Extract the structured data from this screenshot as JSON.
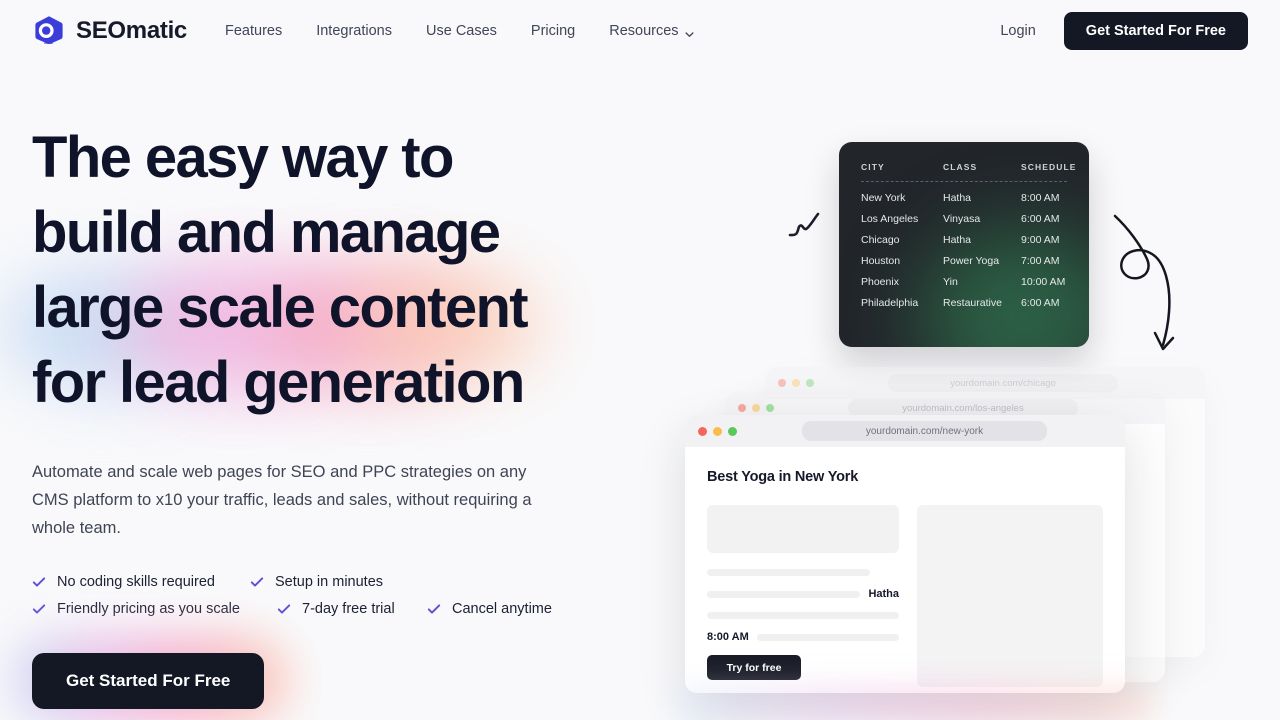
{
  "brand": {
    "name": "SEOmatic",
    "logo_icon": "seomatic-logo-icon",
    "accent": "#3b3ddb"
  },
  "nav": {
    "links": [
      {
        "label": "Features",
        "icon": null
      },
      {
        "label": "Integrations",
        "icon": null
      },
      {
        "label": "Use Cases",
        "icon": null
      },
      {
        "label": "Pricing",
        "icon": null
      },
      {
        "label": "Resources",
        "icon": "chevron-down-icon"
      }
    ],
    "login_label": "Login",
    "cta_label": "Get Started For Free"
  },
  "hero": {
    "headline_line1": "The easy way to",
    "headline_line2": "build and manage",
    "headline_line3": "large scale content",
    "headline_line4": "for lead generation",
    "subheadline": "Automate and scale web pages for SEO and PPC strategies on any CMS platform to x10 your traffic, leads and sales, without requiring a whole team.",
    "features_row1": [
      {
        "label": "No coding skills required",
        "icon": "check-icon"
      },
      {
        "label": "Setup in minutes",
        "icon": "check-icon"
      }
    ],
    "features_row2": [
      {
        "label": "Friendly pricing as you scale",
        "icon": "check-icon"
      },
      {
        "label": "7-day free trial",
        "icon": "check-icon"
      },
      {
        "label": "Cancel anytime",
        "icon": "check-icon"
      }
    ],
    "cta_label": "Get Started For Free",
    "check_color": "#5b4fd6",
    "cta_bg": "#141824"
  },
  "schedule_card": {
    "columns": [
      "CITY",
      "CLASS",
      "SCHEDULE"
    ],
    "rows": [
      {
        "city": "New York",
        "class": "Hatha",
        "schedule": "8:00 AM"
      },
      {
        "city": "Los Angeles",
        "class": "Vinyasa",
        "schedule": "6:00 AM"
      },
      {
        "city": "Chicago",
        "class": "Hatha",
        "schedule": "9:00 AM"
      },
      {
        "city": "Houston",
        "class": "Power Yoga",
        "schedule": "7:00 AM"
      },
      {
        "city": "Phoenix",
        "class": "Yin",
        "schedule": "10:00 AM"
      },
      {
        "city": "Philadelphia",
        "class": "Restaurative",
        "schedule": "6:00 AM"
      }
    ],
    "bg": "#22252a",
    "glow": "#2e6b4a"
  },
  "browser_windows": [
    {
      "url": "yourdomain.com/chicago"
    },
    {
      "url": "yourdomain.com/los-angeles"
    },
    {
      "url": "yourdomain.com/new-york",
      "page_title": "Best Yoga in New York",
      "class_label": "Hatha",
      "time_label": "8:00 AM",
      "button_label": "Try for free"
    }
  ],
  "decorations": {
    "squiggle_icon": "trend-zigzag-icon",
    "arrow_icon": "curly-arrow-icon"
  }
}
